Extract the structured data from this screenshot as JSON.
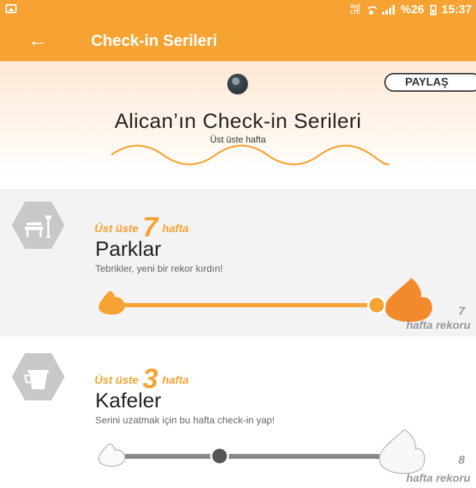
{
  "status_bar": {
    "volte_top": "Vo))",
    "volte_bottom": "LTE",
    "battery_text": "%26",
    "time": "15:37"
  },
  "toolbar": {
    "back_icon": "arrow-left-icon",
    "title": "Check-in Serileri"
  },
  "header": {
    "share_label": "PAYLAŞ",
    "title": "Alican’ın Check-in Serileri",
    "subtitle": "Üst üste hafta"
  },
  "streaks": [
    {
      "icon": "park-bench-icon",
      "prefix": "Üst üste",
      "count": "7",
      "suffix": "hafta",
      "name": "Parklar",
      "message": "Tebrikler, yeni bir rekor kırdın!",
      "record": "7",
      "record_label": "hafta rekoru",
      "progress": 1.0,
      "active": true
    },
    {
      "icon": "coffee-pot-icon",
      "prefix": "Üst üste",
      "count": "3",
      "suffix": "hafta",
      "name": "Kafeler",
      "message": "Serini uzatmak için bu hafta check-in yap!",
      "record": "8",
      "record_label": "hafta rekoru",
      "progress": 0.375,
      "active": false
    }
  ],
  "colors": {
    "accent": "#f6a333",
    "flame_orange": "#f08a2a",
    "gray_track": "#8a8a8a",
    "hex_gray": "#c8c8c8"
  }
}
